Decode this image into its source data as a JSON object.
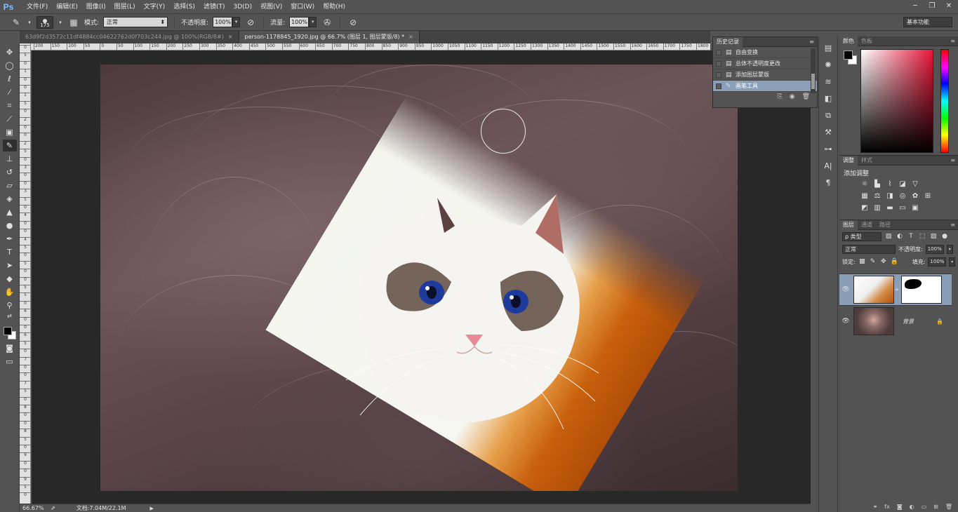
{
  "app": {
    "logo": "Ps"
  },
  "menu": [
    "文件(F)",
    "编辑(E)",
    "图像(I)",
    "图层(L)",
    "文字(Y)",
    "选择(S)",
    "滤镜(T)",
    "3D(D)",
    "视图(V)",
    "窗口(W)",
    "帮助(H)"
  ],
  "window_controls": {
    "minimize": "─",
    "restore": "❐",
    "close": "✕"
  },
  "options": {
    "brush_size": "175",
    "mode_label": "模式:",
    "mode_value": "正常",
    "opacity_label": "不透明度:",
    "opacity_value": "100%",
    "flow_label": "流量:",
    "flow_value": "100%",
    "workspace": "基本功能"
  },
  "tabs": [
    {
      "title": "63d9f2d3572c11df4884cc04622762d0f703c244.jpg @ 100%(RGB/8#)",
      "close": "×"
    },
    {
      "title": "person-1178845_1920.jpg @ 66.7% (图层 1, 图层蒙版/8) *",
      "close": "×"
    }
  ],
  "ruler_top": [
    "200",
    "150",
    "100",
    "50",
    "0",
    "50",
    "100",
    "150",
    "200",
    "250",
    "300",
    "350",
    "400",
    "450",
    "500",
    "550",
    "600",
    "650",
    "700",
    "750",
    "800",
    "850",
    "900",
    "950",
    "1000",
    "1050",
    "1100",
    "1150",
    "1200",
    "1250",
    "1300",
    "1350",
    "1400",
    "1450",
    "1500",
    "1550",
    "1600",
    "1650",
    "1700",
    "1750",
    "1800"
  ],
  "ruler_left": [
    "0",
    "5",
    "0",
    "1",
    "0",
    "0",
    "1",
    "5",
    "0",
    "2",
    "0",
    "0",
    "2",
    "5",
    "0",
    "3",
    "0",
    "0",
    "3",
    "5",
    "0",
    "4",
    "0",
    "0",
    "4",
    "5",
    "0",
    "5",
    "0",
    "0",
    "5",
    "5",
    "0",
    "6",
    "0",
    "0",
    "6",
    "5",
    "0",
    "7",
    "0",
    "0",
    "7",
    "5",
    "0",
    "8",
    "0",
    "0",
    "8",
    "5",
    "0",
    "9",
    "0",
    "0",
    "9",
    "5",
    "0"
  ],
  "history": {
    "tab": "历史记录",
    "items": [
      {
        "label": "自由变换",
        "icon": "history-doc-icon"
      },
      {
        "label": "总体不透明度更改",
        "icon": "history-doc-icon"
      },
      {
        "label": "添加图层蒙版",
        "icon": "history-doc-icon"
      },
      {
        "label": "画笔工具",
        "icon": "brush-icon",
        "selected": true
      }
    ]
  },
  "color_panel": {
    "tab_color": "颜色",
    "tab_swatches": "色板",
    "hue_color": "#e8163a"
  },
  "adjust_panel": {
    "tab_adjust": "调整",
    "tab_styles": "样式",
    "title": "添加调整"
  },
  "layers_panel": {
    "tab_layers": "图层",
    "tab_channels": "通道",
    "tab_paths": "路径",
    "kind_label": "ρ 类型",
    "blend_mode": "正常",
    "opacity_label": "不透明度:",
    "opacity_value": "100%",
    "lock_label": "锁定:",
    "fill_label": "填充:",
    "fill_value": "100%",
    "background_name": "背景"
  },
  "status": {
    "zoom": "66.67%",
    "doc_size": "文档:7.04M/22.1M"
  }
}
